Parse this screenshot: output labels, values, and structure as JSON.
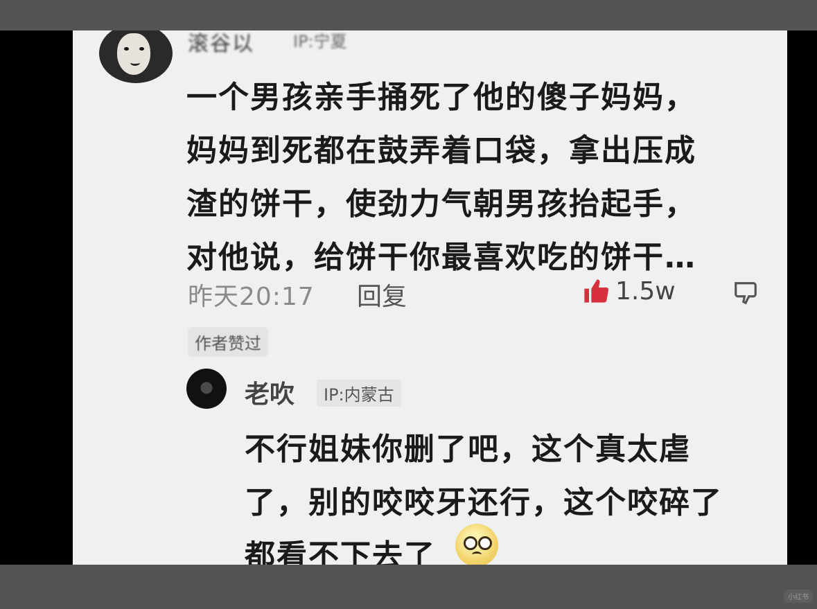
{
  "comment": {
    "username": "滚谷以",
    "ip": "IP:宁夏",
    "text": "一个男孩亲手捅死了他的傻子妈妈，\n妈妈到死都在鼓弄着口袋，拿出压成\n渣的饼干，使劲力气朝男孩抬起手，\n对他说，给饼干你最喜欢吃的饼干…",
    "time": "昨天20:17",
    "reply_label": "回复",
    "like_count": "1.5w",
    "author_tag": "作者赞过"
  },
  "reply": {
    "username": "老吹",
    "ip": "IP:内蒙古",
    "text": "不行姐妹你删了吧，这个真太虐\n了，别的咬咬牙还行，这个咬碎了\n都看不下去了"
  },
  "colors": {
    "like": "#d6303d",
    "card": "#eef0f2",
    "bar": "#545454"
  },
  "watermark": "小红书"
}
